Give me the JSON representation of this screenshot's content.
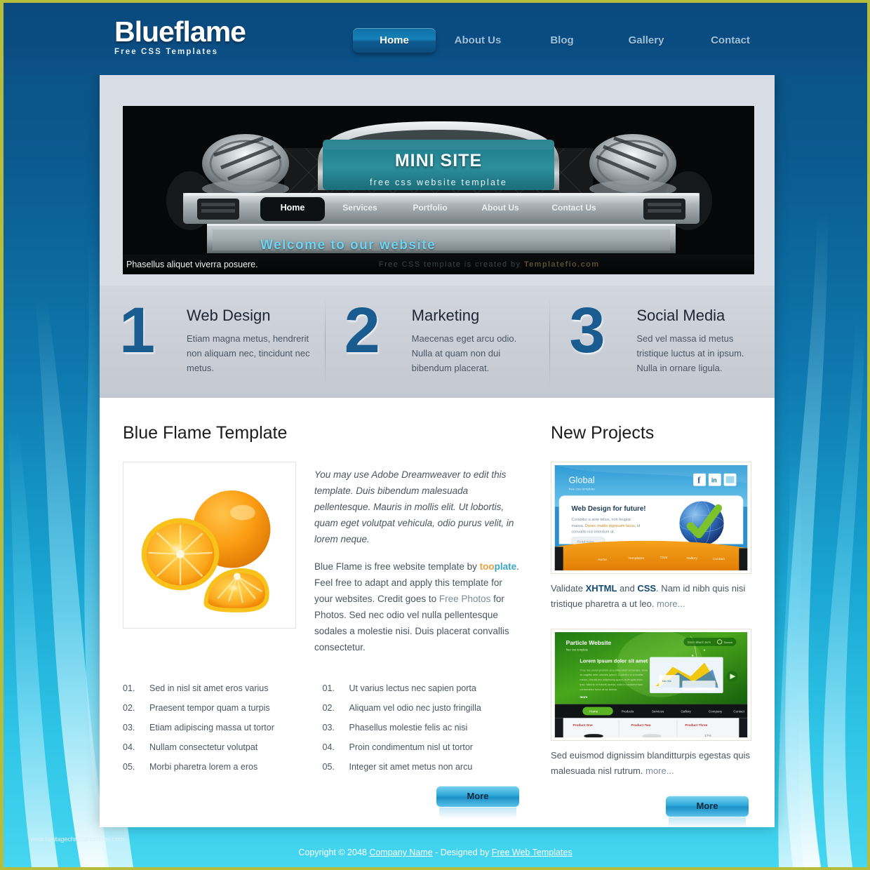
{
  "site": {
    "logo_title": "Blueflame",
    "logo_subtitle": "Free CSS Templates"
  },
  "nav": {
    "items": [
      {
        "label": "Home",
        "active": true
      },
      {
        "label": "About Us",
        "active": false
      },
      {
        "label": "Blog",
        "active": false
      },
      {
        "label": "Gallery",
        "active": false
      },
      {
        "label": "Contact",
        "active": false
      }
    ]
  },
  "banner": {
    "headline": "MINI SITE",
    "tagline": "free css website template",
    "menu": [
      "Home",
      "Services",
      "Portfolio",
      "About Us",
      "Contact Us"
    ],
    "welcome": "Welcome to our website",
    "caption_left": "Phasellus aliquet viverra posuere.",
    "caption_right_pre": "Free CSS template is created by ",
    "caption_right_link": "Templatefio.com"
  },
  "features": [
    {
      "number": "1",
      "title": "Web Design",
      "text": "Etiam magna metus, hendrerit non aliquam nec, tincidunt nec metus."
    },
    {
      "number": "2",
      "title": "Marketing",
      "text": "Maecenas eget arcu odio. Nulla at quam non dui bibendum placerat."
    },
    {
      "number": "3",
      "title": "Social Media",
      "text": "Sed vel massa id metus tristique luctus at in ipsum. Nulla in ornare ligula."
    }
  ],
  "main": {
    "title": "Blue Flame Template",
    "lead": "You may use Adobe Dreamweaver to edit this template. Duis bibendum malesuada pellentesque. Mauris in mollis elit. Ut lobortis, quam eget volutpat vehicula, odio purus velit, in lorem neque.",
    "body_1": "Blue Flame is free website template by ",
    "link_tooplate_a": "too",
    "link_tooplate_b": "plate",
    "body_2": ". Feel free to adapt and apply this template for your websites. Credit goes to ",
    "link_free_photos": "Free Photos",
    "body_3": " for Photos. Sed nec odio vel nulla pellentesque sodales a molestie nisi. Duis placerat convallis consectetur.",
    "list_left": [
      {
        "n": "01.",
        "text": "Sed in nisl sit amet eros varius"
      },
      {
        "n": "02.",
        "text": "Praesent tempor quam a turpis"
      },
      {
        "n": "03.",
        "text": "Etiam adipiscing massa ut tortor"
      },
      {
        "n": "04.",
        "text": "Nullam consectetur volutpat"
      },
      {
        "n": "05.",
        "text": "Morbi pharetra lorem a eros"
      }
    ],
    "list_right": [
      {
        "n": "01.",
        "text": "Ut varius lectus nec sapien porta"
      },
      {
        "n": "02.",
        "text": "Aliquam vel odio nec justo fringilla"
      },
      {
        "n": "03.",
        "text": "Phasellus molestie felis ac nisi"
      },
      {
        "n": "04.",
        "text": "Proin condimentum nisl ut tortor"
      },
      {
        "n": "05.",
        "text": "Integer sit amet metus non arcu"
      }
    ],
    "more_button": "More"
  },
  "sidebar": {
    "title": "New Projects",
    "more_button": "More",
    "projects": [
      {
        "thumb_brand": "Global",
        "thumb_brand_sub": "free css template",
        "thumb_heading": "Web Design for future!",
        "thumb_body": "Curabitur a ante tellus, non feugiat massa. Donec mattis dignissim lacus, id convallis nisl interdum at.",
        "thumb_button": "Read more",
        "thumb_menu": [
          "Home",
          "Templates",
          "Chat",
          "Gallery",
          "Contact"
        ],
        "caption_pre": "Validate ",
        "caption_b1": "XHTML",
        "caption_mid": " and ",
        "caption_b2": "CSS",
        "caption_post": ". Nam id nibh quis nisi tristique pharetra a ut leo. ",
        "caption_more": "more..."
      },
      {
        "thumb_brand": "Particle Website",
        "thumb_brand_sub": "free css template",
        "thumb_heading": "Lorem Ipsum dolor sit amet",
        "thumb_button": "more",
        "thumb_menu": [
          "Home",
          "Products",
          "Services",
          "Gallery",
          "Company",
          "Contact"
        ],
        "thumb_products": [
          "Product One",
          "Product Two",
          "Product Three"
        ],
        "caption_pre": "Sed euismod dignissim blanditturpis egestas quis malesuada nisl rutrum. ",
        "caption_more": "more..."
      }
    ]
  },
  "footer": {
    "watermark": "www.heritagechristiancollege.com",
    "copyright_pre": "Copyright © 2048 ",
    "company": "Company Name",
    "mid": " - Designed by ",
    "designer": "Free Web Templates"
  },
  "colors": {
    "accent_blue": "#0a4f82",
    "page_border": "#b6bd3c",
    "feature_number": "#1a5c8f",
    "link_orange": "#e8a33d",
    "link_teal": "#3aa6c4"
  }
}
